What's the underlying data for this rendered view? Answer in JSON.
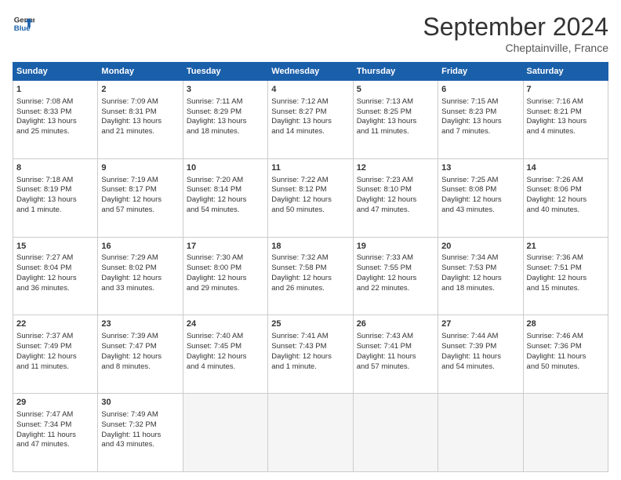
{
  "logo": {
    "line1": "General",
    "line2": "Blue"
  },
  "title": "September 2024",
  "location": "Cheptainville, France",
  "headers": [
    "Sunday",
    "Monday",
    "Tuesday",
    "Wednesday",
    "Thursday",
    "Friday",
    "Saturday"
  ],
  "weeks": [
    [
      {
        "day": "1",
        "lines": [
          "Sunrise: 7:08 AM",
          "Sunset: 8:33 PM",
          "Daylight: 13 hours",
          "and 25 minutes."
        ]
      },
      {
        "day": "2",
        "lines": [
          "Sunrise: 7:09 AM",
          "Sunset: 8:31 PM",
          "Daylight: 13 hours",
          "and 21 minutes."
        ]
      },
      {
        "day": "3",
        "lines": [
          "Sunrise: 7:11 AM",
          "Sunset: 8:29 PM",
          "Daylight: 13 hours",
          "and 18 minutes."
        ]
      },
      {
        "day": "4",
        "lines": [
          "Sunrise: 7:12 AM",
          "Sunset: 8:27 PM",
          "Daylight: 13 hours",
          "and 14 minutes."
        ]
      },
      {
        "day": "5",
        "lines": [
          "Sunrise: 7:13 AM",
          "Sunset: 8:25 PM",
          "Daylight: 13 hours",
          "and 11 minutes."
        ]
      },
      {
        "day": "6",
        "lines": [
          "Sunrise: 7:15 AM",
          "Sunset: 8:23 PM",
          "Daylight: 13 hours",
          "and 7 minutes."
        ]
      },
      {
        "day": "7",
        "lines": [
          "Sunrise: 7:16 AM",
          "Sunset: 8:21 PM",
          "Daylight: 13 hours",
          "and 4 minutes."
        ]
      }
    ],
    [
      {
        "day": "8",
        "lines": [
          "Sunrise: 7:18 AM",
          "Sunset: 8:19 PM",
          "Daylight: 13 hours",
          "and 1 minute."
        ]
      },
      {
        "day": "9",
        "lines": [
          "Sunrise: 7:19 AM",
          "Sunset: 8:17 PM",
          "Daylight: 12 hours",
          "and 57 minutes."
        ]
      },
      {
        "day": "10",
        "lines": [
          "Sunrise: 7:20 AM",
          "Sunset: 8:14 PM",
          "Daylight: 12 hours",
          "and 54 minutes."
        ]
      },
      {
        "day": "11",
        "lines": [
          "Sunrise: 7:22 AM",
          "Sunset: 8:12 PM",
          "Daylight: 12 hours",
          "and 50 minutes."
        ]
      },
      {
        "day": "12",
        "lines": [
          "Sunrise: 7:23 AM",
          "Sunset: 8:10 PM",
          "Daylight: 12 hours",
          "and 47 minutes."
        ]
      },
      {
        "day": "13",
        "lines": [
          "Sunrise: 7:25 AM",
          "Sunset: 8:08 PM",
          "Daylight: 12 hours",
          "and 43 minutes."
        ]
      },
      {
        "day": "14",
        "lines": [
          "Sunrise: 7:26 AM",
          "Sunset: 8:06 PM",
          "Daylight: 12 hours",
          "and 40 minutes."
        ]
      }
    ],
    [
      {
        "day": "15",
        "lines": [
          "Sunrise: 7:27 AM",
          "Sunset: 8:04 PM",
          "Daylight: 12 hours",
          "and 36 minutes."
        ]
      },
      {
        "day": "16",
        "lines": [
          "Sunrise: 7:29 AM",
          "Sunset: 8:02 PM",
          "Daylight: 12 hours",
          "and 33 minutes."
        ]
      },
      {
        "day": "17",
        "lines": [
          "Sunrise: 7:30 AM",
          "Sunset: 8:00 PM",
          "Daylight: 12 hours",
          "and 29 minutes."
        ]
      },
      {
        "day": "18",
        "lines": [
          "Sunrise: 7:32 AM",
          "Sunset: 7:58 PM",
          "Daylight: 12 hours",
          "and 26 minutes."
        ]
      },
      {
        "day": "19",
        "lines": [
          "Sunrise: 7:33 AM",
          "Sunset: 7:55 PM",
          "Daylight: 12 hours",
          "and 22 minutes."
        ]
      },
      {
        "day": "20",
        "lines": [
          "Sunrise: 7:34 AM",
          "Sunset: 7:53 PM",
          "Daylight: 12 hours",
          "and 18 minutes."
        ]
      },
      {
        "day": "21",
        "lines": [
          "Sunrise: 7:36 AM",
          "Sunset: 7:51 PM",
          "Daylight: 12 hours",
          "and 15 minutes."
        ]
      }
    ],
    [
      {
        "day": "22",
        "lines": [
          "Sunrise: 7:37 AM",
          "Sunset: 7:49 PM",
          "Daylight: 12 hours",
          "and 11 minutes."
        ]
      },
      {
        "day": "23",
        "lines": [
          "Sunrise: 7:39 AM",
          "Sunset: 7:47 PM",
          "Daylight: 12 hours",
          "and 8 minutes."
        ]
      },
      {
        "day": "24",
        "lines": [
          "Sunrise: 7:40 AM",
          "Sunset: 7:45 PM",
          "Daylight: 12 hours",
          "and 4 minutes."
        ]
      },
      {
        "day": "25",
        "lines": [
          "Sunrise: 7:41 AM",
          "Sunset: 7:43 PM",
          "Daylight: 12 hours",
          "and 1 minute."
        ]
      },
      {
        "day": "26",
        "lines": [
          "Sunrise: 7:43 AM",
          "Sunset: 7:41 PM",
          "Daylight: 11 hours",
          "and 57 minutes."
        ]
      },
      {
        "day": "27",
        "lines": [
          "Sunrise: 7:44 AM",
          "Sunset: 7:39 PM",
          "Daylight: 11 hours",
          "and 54 minutes."
        ]
      },
      {
        "day": "28",
        "lines": [
          "Sunrise: 7:46 AM",
          "Sunset: 7:36 PM",
          "Daylight: 11 hours",
          "and 50 minutes."
        ]
      }
    ],
    [
      {
        "day": "29",
        "lines": [
          "Sunrise: 7:47 AM",
          "Sunset: 7:34 PM",
          "Daylight: 11 hours",
          "and 47 minutes."
        ]
      },
      {
        "day": "30",
        "lines": [
          "Sunrise: 7:49 AM",
          "Sunset: 7:32 PM",
          "Daylight: 11 hours",
          "and 43 minutes."
        ]
      },
      {
        "day": "",
        "lines": []
      },
      {
        "day": "",
        "lines": []
      },
      {
        "day": "",
        "lines": []
      },
      {
        "day": "",
        "lines": []
      },
      {
        "day": "",
        "lines": []
      }
    ]
  ]
}
